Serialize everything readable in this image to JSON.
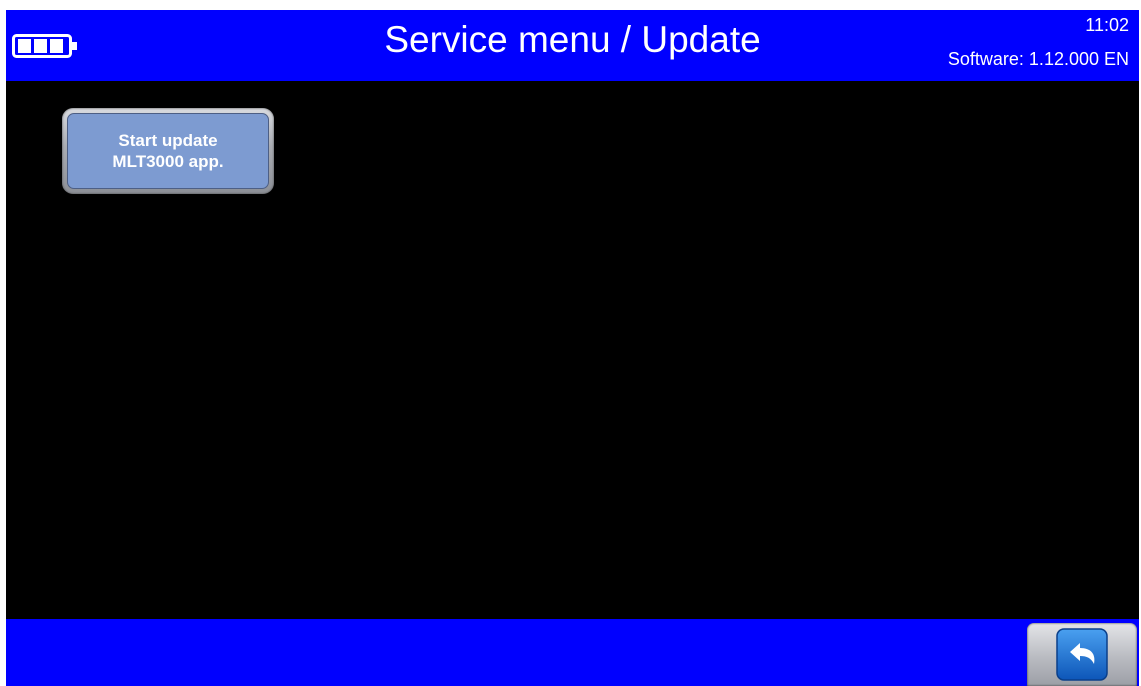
{
  "header": {
    "title": "Service menu / Update",
    "time": "11:02",
    "software": "Software: 1.12.000 EN",
    "battery_icon": "battery-icon",
    "battery_bars": 3,
    "background_color": "#0000ff"
  },
  "main": {
    "update_button": {
      "line1": "Start update",
      "line2": "MLT3000 app.",
      "color": "#7d9bd1"
    }
  },
  "footer": {
    "back_icon": "back-arrow-icon",
    "background_color": "#0000ff"
  }
}
